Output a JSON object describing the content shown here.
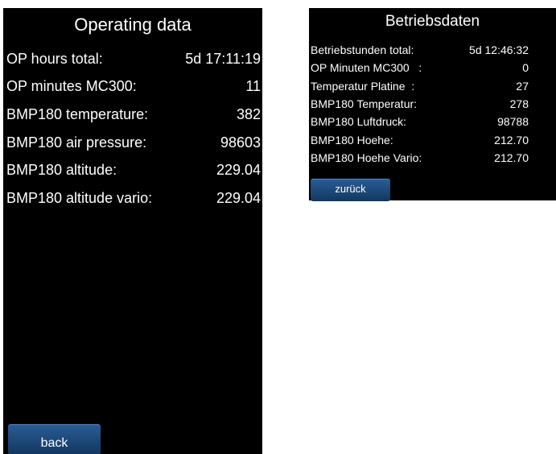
{
  "screen_en": {
    "title": "Operating data",
    "rows": [
      {
        "label": "OP hours total:",
        "value": "5d 17:11:19"
      },
      {
        "label": "OP minutes MC300:",
        "value": "11"
      },
      {
        "label": "BMP180 temperature:",
        "value": "382"
      },
      {
        "label": "BMP180 air pressure:",
        "value": "98603"
      },
      {
        "label": "BMP180 altitude:",
        "value": "229.04"
      },
      {
        "label": "BMP180 altitude vario:",
        "value": "229.04"
      }
    ],
    "back_label": "back"
  },
  "screen_de": {
    "title": "Betriebsdaten",
    "rows": [
      {
        "label": "Betriebstunden total:",
        "value": "5d 12:46:32"
      },
      {
        "label": "OP Minuten MC300   :",
        "value": "0"
      },
      {
        "label": "Temperatur Platine  :",
        "value": "27"
      },
      {
        "label": "BMP180 Temperatur:",
        "value": "278"
      },
      {
        "label": "BMP180 Luftdruck:",
        "value": "98788"
      },
      {
        "label": "BMP180 Hoehe:",
        "value": "212.70"
      },
      {
        "label": "BMP180 Hoehe Vario:",
        "value": "212.70"
      }
    ],
    "back_label": "zurück"
  },
  "colors": {
    "screen_background": "#000000",
    "text": "#ffffff",
    "button_top": "#2a5c95",
    "button_bottom": "#12375f"
  }
}
